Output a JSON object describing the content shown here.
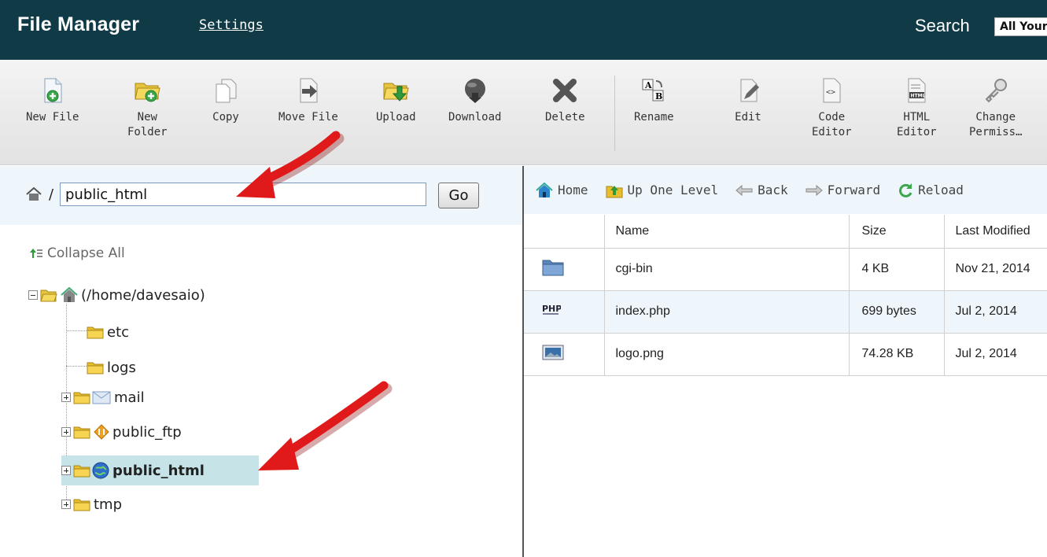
{
  "header": {
    "title": "File Manager",
    "settings_link": "Settings",
    "search_label": "Search",
    "search_scope": "All Your Files"
  },
  "toolbar": {
    "buttons": [
      {
        "label": "New File",
        "icon": "new-file-icon"
      },
      {
        "label": "New\nFolder",
        "icon": "new-folder-icon"
      },
      {
        "label": "Copy",
        "icon": "copy-icon"
      },
      {
        "label": "Move File",
        "icon": "move-file-icon"
      },
      {
        "label": "Upload",
        "icon": "upload-icon"
      },
      {
        "label": "Download",
        "icon": "download-icon"
      },
      {
        "label": "Delete",
        "icon": "delete-icon"
      },
      {
        "label": "Rename",
        "icon": "rename-icon"
      },
      {
        "label": "Edit",
        "icon": "edit-icon"
      },
      {
        "label": "Code\nEditor",
        "icon": "code-editor-icon"
      },
      {
        "label": "HTML\nEditor",
        "icon": "html-editor-icon"
      },
      {
        "label": "Change\nPermiss…",
        "icon": "key-icon"
      }
    ]
  },
  "left": {
    "path_slash": "/",
    "path_value": "public_html",
    "go_label": "Go",
    "collapse_label": "Collapse All",
    "tree": {
      "root": "(/home/davesaio)",
      "items": [
        "etc",
        "logs",
        "mail",
        "public_ftp",
        "public_html",
        "tmp"
      ]
    }
  },
  "right": {
    "nav": {
      "home": "Home",
      "up": "Up One Level",
      "back": "Back",
      "forward": "Forward",
      "reload": "Reload"
    },
    "columns": [
      "Name",
      "Size",
      "Last Modified"
    ],
    "rows": [
      {
        "name": "cgi-bin",
        "size": "4 KB",
        "modified": "Nov 21, 2014",
        "icon": "folder-icon"
      },
      {
        "name": "index.php",
        "size": "699 bytes",
        "modified": "Jul 2, 2014",
        "icon": "php-file-icon"
      },
      {
        "name": "logo.png",
        "size": "74.28 KB",
        "modified": "Jul 2, 2014",
        "icon": "image-file-icon"
      }
    ]
  },
  "colors": {
    "header_bg": "#0f3a46",
    "arrow": "#e01a1a",
    "selection": "#c6e4e8"
  }
}
